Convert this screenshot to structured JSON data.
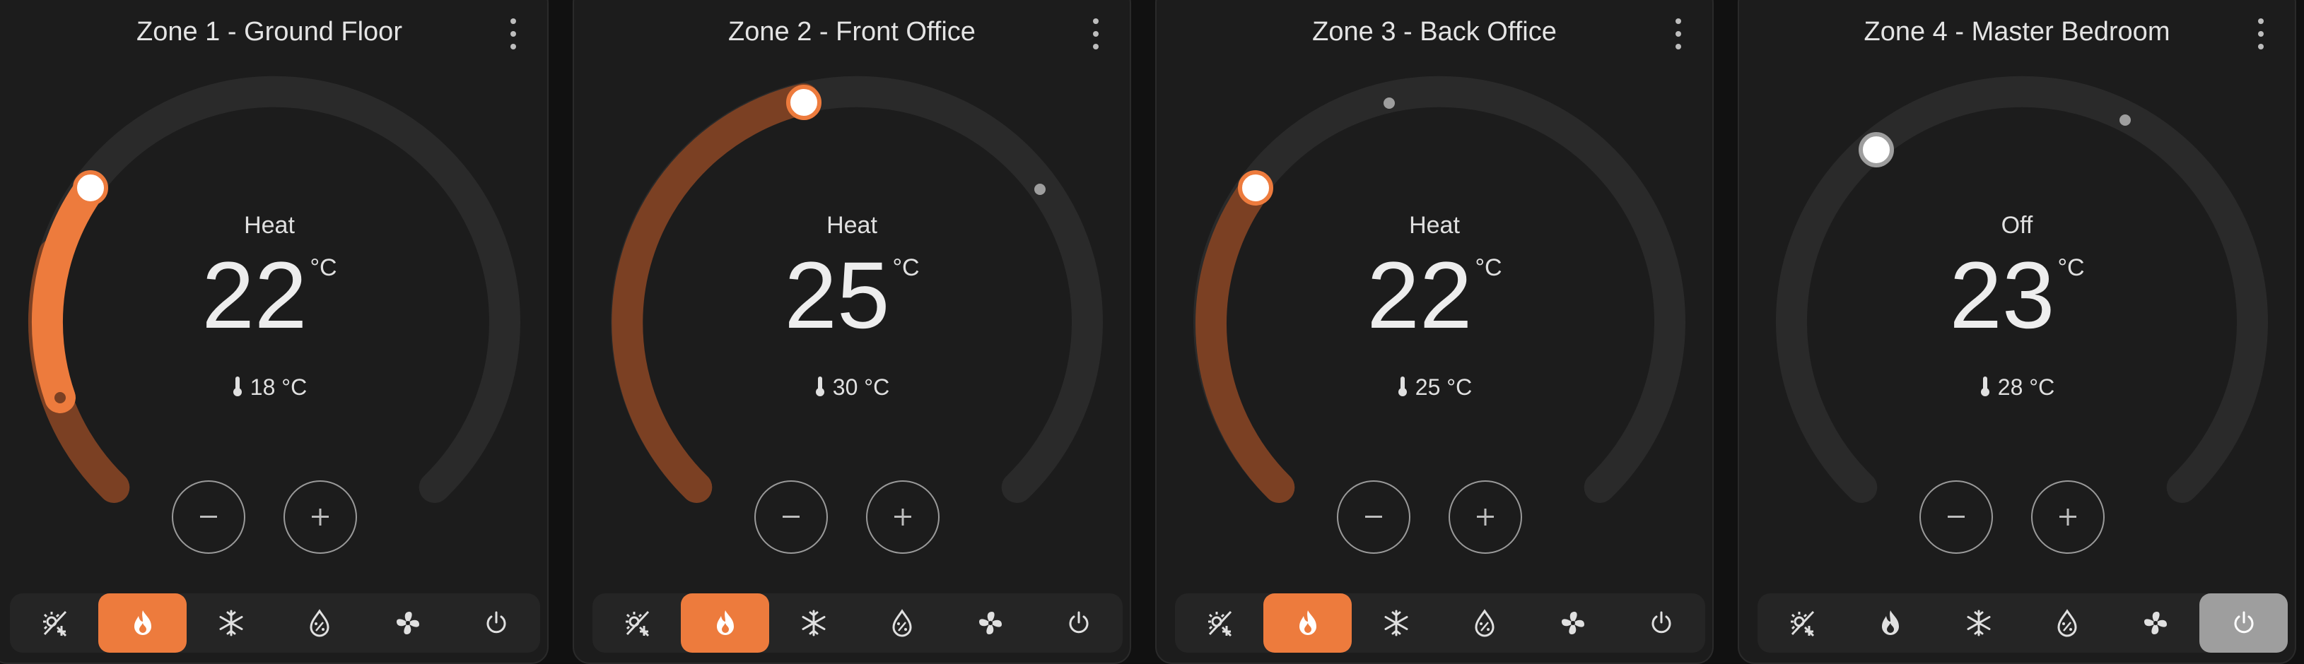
{
  "colors": {
    "heat_accent": "#ed7b3d",
    "heat_arc_dim": "#7b4023",
    "off_accent": "#9e9e9e",
    "track": "#2a2a2a",
    "card_bg": "#1c1c1c"
  },
  "zones": [
    {
      "title": "Zone 1 - Ground Floor",
      "mode": "Heat",
      "target": "22",
      "unit": "°C",
      "current": "18 °C",
      "active_mode": "heat",
      "modes": [
        "heat_cool",
        "heat",
        "cool",
        "dry",
        "fan_only",
        "off"
      ]
    },
    {
      "title": "Zone 2 - Front Office",
      "mode": "Heat",
      "target": "25",
      "unit": "°C",
      "current": "30 °C",
      "active_mode": "heat",
      "modes": [
        "heat_cool",
        "heat",
        "cool",
        "dry",
        "fan_only",
        "off"
      ]
    },
    {
      "title": "Zone 3 - Back Office",
      "mode": "Heat",
      "target": "22",
      "unit": "°C",
      "current": "25 °C",
      "active_mode": "heat",
      "modes": [
        "heat_cool",
        "heat",
        "cool",
        "dry",
        "fan_only",
        "off"
      ]
    },
    {
      "title": "Zone 4 - Master Bedroom",
      "mode": "Off",
      "target": "23",
      "unit": "°C",
      "current": "28 °C",
      "active_mode": "off",
      "modes": [
        "heat_cool",
        "heat",
        "cool",
        "dry",
        "fan_only",
        "off"
      ]
    }
  ],
  "icons": {
    "heat_cool": "sun-snowflake-icon",
    "heat": "fire-icon",
    "cool": "snowflake-icon",
    "dry": "water-percent-icon",
    "fan_only": "fan-icon",
    "off": "power-icon",
    "minus": "minus-icon",
    "plus": "plus-icon",
    "menu": "dots-vertical-icon",
    "thermometer": "thermometer-icon"
  }
}
